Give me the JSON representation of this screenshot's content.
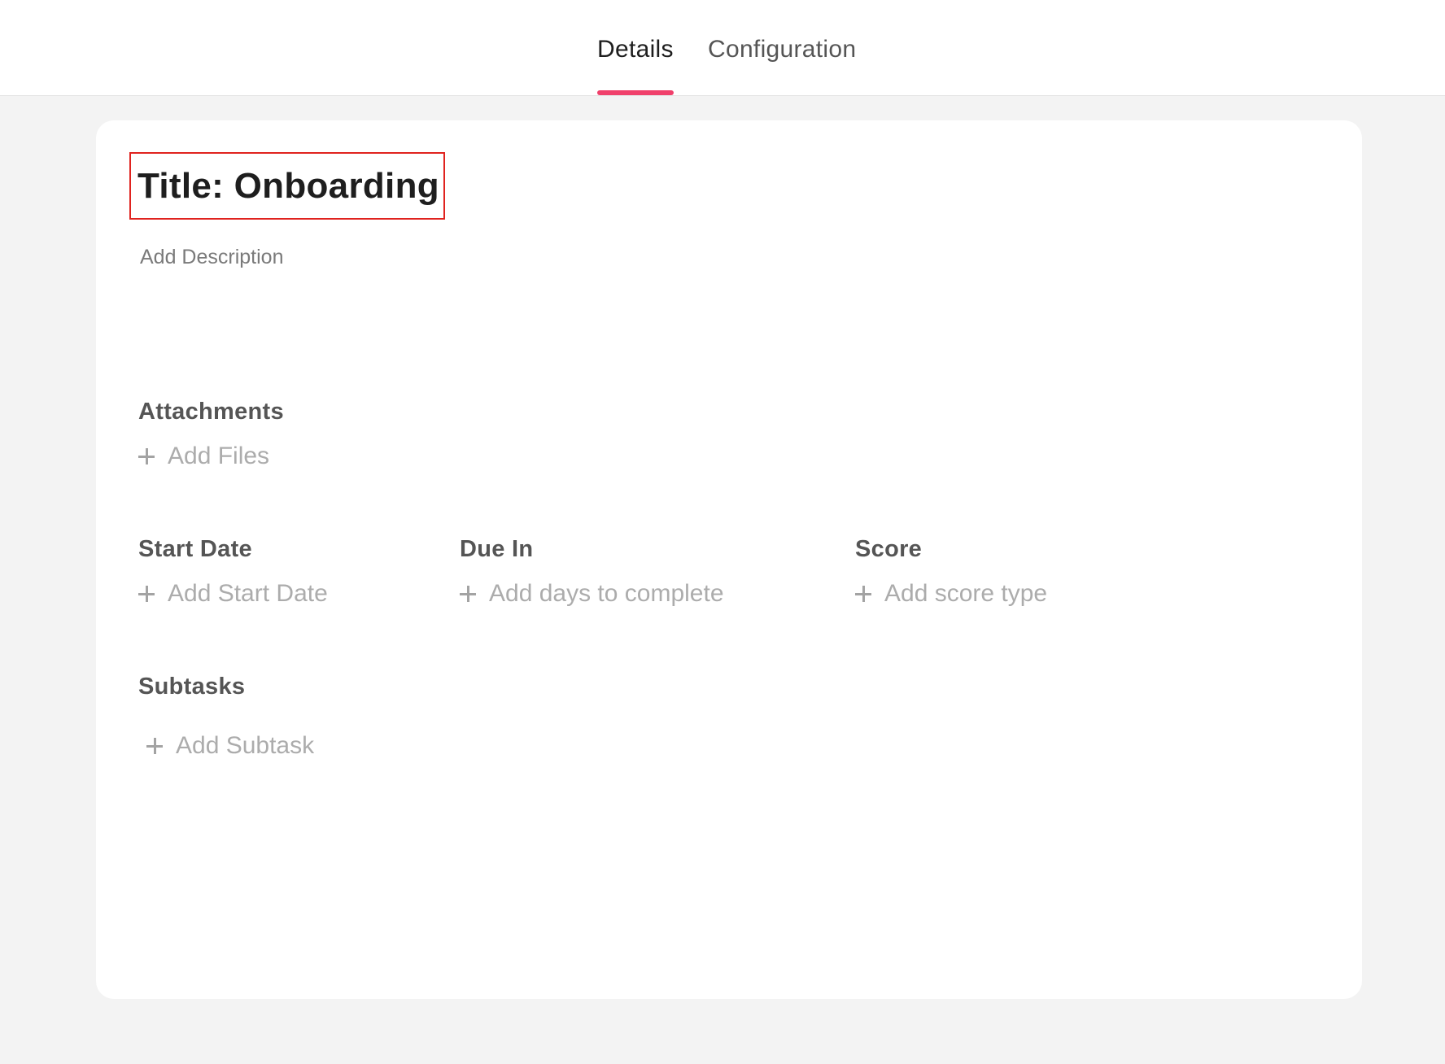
{
  "tabs": [
    {
      "label": "Details",
      "active": true
    },
    {
      "label": "Configuration",
      "active": false
    }
  ],
  "accent_color": "#f0406b",
  "highlight_color": "#e0231f",
  "task": {
    "title": "Title: Onboarding",
    "description_placeholder": "Add Description"
  },
  "attachments": {
    "label": "Attachments",
    "action": "Add Files"
  },
  "start_date": {
    "label": "Start Date",
    "action": "Add Start Date"
  },
  "due_in": {
    "label": "Due In",
    "action": "Add days to complete"
  },
  "score": {
    "label": "Score",
    "action": "Add score type"
  },
  "subtasks": {
    "label": "Subtasks",
    "action": "Add Subtask"
  }
}
